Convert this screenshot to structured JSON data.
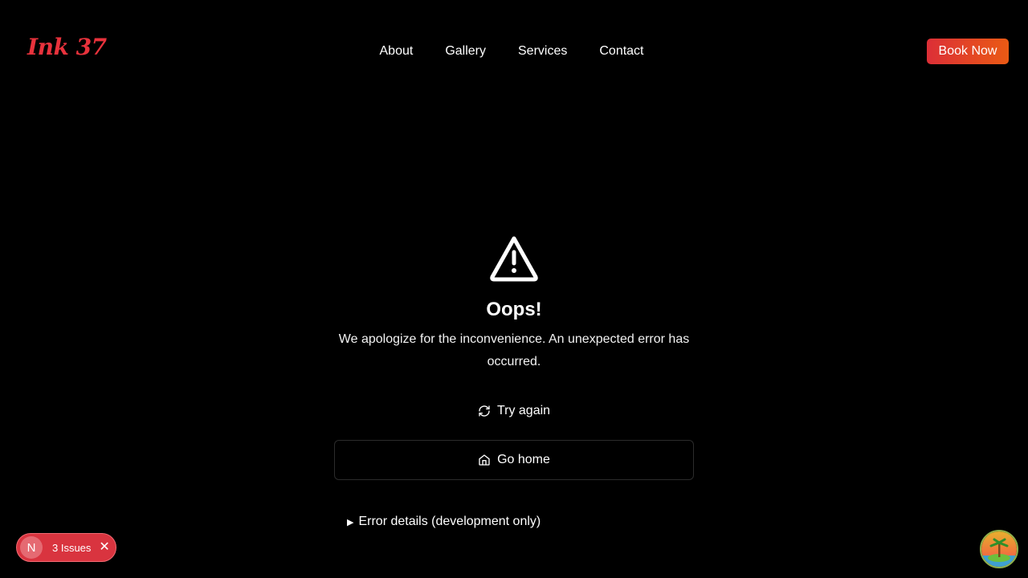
{
  "header": {
    "logo": "Ink 37",
    "nav": [
      "About",
      "Gallery",
      "Services",
      "Contact"
    ],
    "cta_label": "Book Now"
  },
  "error": {
    "icon": "alert-triangle-icon",
    "title": "Oops!",
    "message": "We apologize for the inconvenience. An unexpected error has occurred.",
    "retry_label": "Try again",
    "retry_icon": "refresh-icon",
    "home_label": "Go home",
    "home_icon": "home-icon",
    "details_label": "Error details (development only)"
  },
  "dev_overlay": {
    "badge_letter": "N",
    "issues_label": "3 Issues",
    "close_glyph": "✕"
  },
  "colors": {
    "brand": "#e8323c",
    "cta_start": "#dc2f37",
    "cta_end": "#ea5a14",
    "background": "#000000"
  }
}
